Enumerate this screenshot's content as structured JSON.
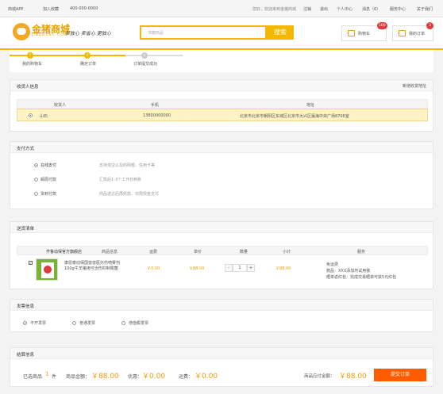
{
  "topbar": {
    "app": "商城APP",
    "fav": "加入收藏",
    "phone": "400-000-0000",
    "welcome": "您好，欢迎来到金猪商城",
    "login": "注销",
    "logout": "退出",
    "account": "个人中心",
    "messages": "消息（6）",
    "service": "服务中心",
    "about": "关于我们"
  },
  "header": {
    "logo_name": "金猪商城",
    "logo_domain": "JINZHUSC.COM",
    "slogan": "买放心 卖省心 更放心",
    "search_placeholder": "书籍商品",
    "search_button": "搜索",
    "cart_label": "购物车",
    "cart_count": "100",
    "orders_label": "我的订单",
    "orders_count": "3"
  },
  "steps": [
    {
      "num": "1",
      "label": "我的购物车"
    },
    {
      "num": "2",
      "label": "确定订单"
    },
    {
      "num": "3",
      "label": "订单提交成功"
    }
  ],
  "address": {
    "title": "收货人信息",
    "add_link": "新增收货地址",
    "cols": [
      "收货人",
      "手机",
      "地址"
    ],
    "row": {
      "name": "山石",
      "phone": "13800000000",
      "address": "北京市北京市朝阳区东城区北京市大兴区瀛海中央广场8706室"
    }
  },
  "payment": {
    "title": "支付方式",
    "options": [
      {
        "label": "在线支付",
        "desc": "支持淘宝以及的网银、信用卡等",
        "selected": true
      },
      {
        "label": "邮局付款",
        "desc": "汇款后1-3个工作日到账",
        "selected": false
      },
      {
        "label": "货到付款",
        "desc": "商品送达后再收款，仅限现金支付",
        "selected": false
      }
    ]
  },
  "shipping": {
    "title": "送货清单",
    "cols": [
      "商品信息",
      "运费",
      "单价",
      "数量",
      "小计",
      "服务"
    ],
    "store": "齐鲁动保官方旗舰店",
    "item": {
      "name": "康恩泰动保国兽兽医外伤喷雾剂 100g牛羊猪用可治伤抑制霉菌",
      "freight": "￥0.00",
      "price": "￥88.00",
      "qty": "1",
      "subtotal": "￥88.00",
      "service1": "免运费",
      "service2": "赠品：XXX添加剂试用装",
      "service3": "晒单返红包：完成交易晒单可获5元红包"
    }
  },
  "invoice": {
    "title": "发票信息",
    "options": [
      {
        "label": "不开发票",
        "selected": true
      },
      {
        "label": "普通发票",
        "selected": false
      },
      {
        "label": "增值税发票",
        "selected": false
      }
    ]
  },
  "settle": {
    "title": "结算信息",
    "count_label": "已选商品",
    "count": "1",
    "count_unit": "件",
    "amount_label": "商品金额：",
    "amount": "￥88.00",
    "discount_label": "优惠：",
    "discount": "￥0.00",
    "freight_label": "运费：",
    "freight": "￥0.00",
    "payable_label": "商品应付金额：",
    "payable": "￥88.00",
    "submit": "提交订单"
  },
  "colors": {
    "accent": "#f5b800",
    "red": "#e4393c",
    "orange": "#ff5c00"
  }
}
